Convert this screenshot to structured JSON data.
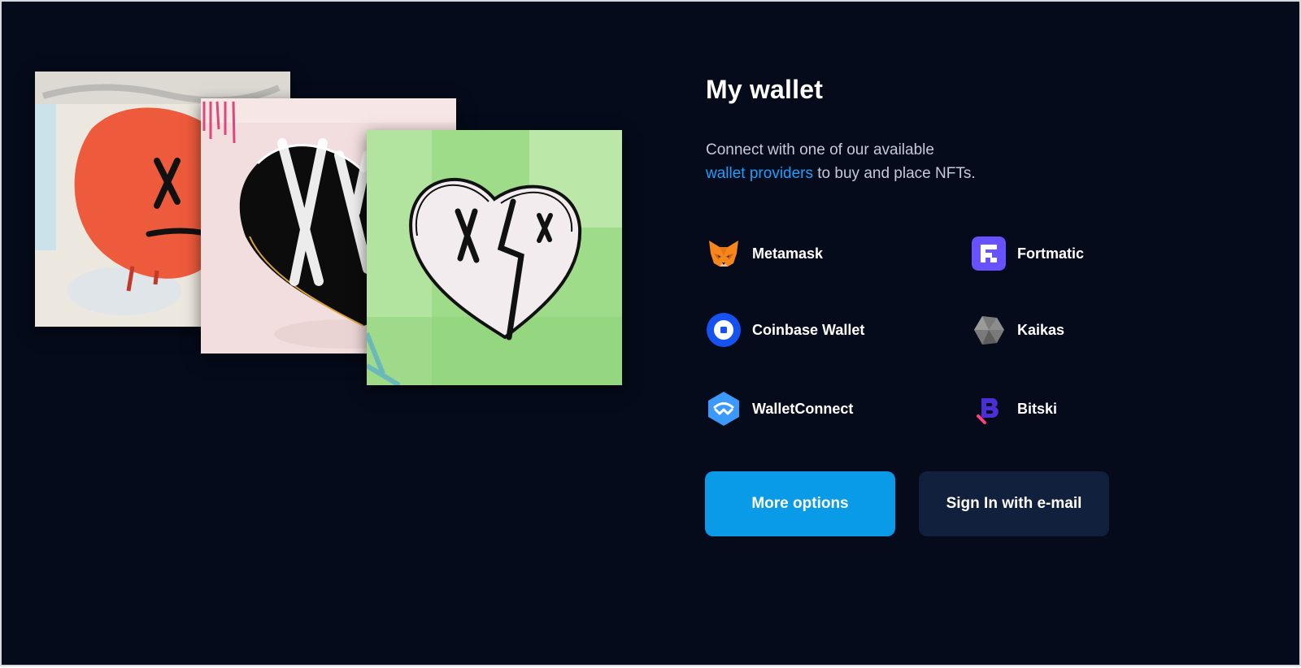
{
  "wallet": {
    "title": "My wallet",
    "description_prefix": "Connect with one of our available",
    "description_link": "wallet providers",
    "description_suffix": "to buy and place NFTs."
  },
  "providers": [
    {
      "label": "Metamask",
      "icon": "metamask-fox-icon",
      "color": "#f6851b"
    },
    {
      "label": "Fortmatic",
      "icon": "fortmatic-icon",
      "color": "#6851ff"
    },
    {
      "label": "Coinbase Wallet",
      "icon": "coinbase-icon",
      "color": "#1652f0"
    },
    {
      "label": "Kaikas",
      "icon": "kaikas-icon",
      "color": "#8a8a8a"
    },
    {
      "label": "WalletConnect",
      "icon": "walletconnect-icon",
      "color": "#3b99fc"
    },
    {
      "label": "Bitski",
      "icon": "bitski-icon",
      "color": "#4b2fd6"
    }
  ],
  "buttons": {
    "more_options": "More options",
    "sign_in_email": "Sign In with e-mail"
  },
  "artworks": [
    {
      "name": "red-heart-artwork"
    },
    {
      "name": "black-heart-artwork"
    },
    {
      "name": "green-heart-artwork"
    }
  ],
  "colors": {
    "background": "#050b1b",
    "accent": "#0a9be8",
    "link": "#1e9fff",
    "secondary_button": "#11203d"
  }
}
